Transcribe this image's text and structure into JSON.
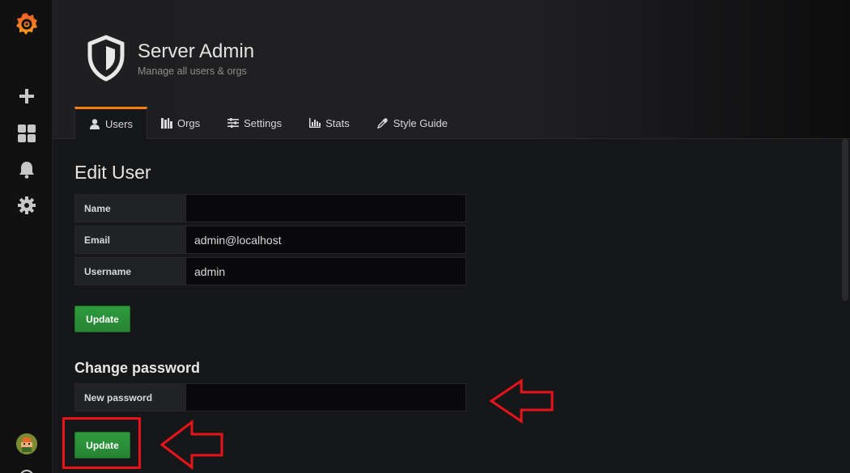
{
  "header": {
    "title": "Server Admin",
    "subtitle": "Manage all users & orgs"
  },
  "sidebar": {
    "icons": [
      "grafana-logo",
      "plus-icon",
      "dashboards-icon",
      "bell-icon",
      "gear-icon",
      "user-avatar",
      "help-icon"
    ]
  },
  "tabs": [
    {
      "label": "Users",
      "icon": "user-icon",
      "active": true
    },
    {
      "label": "Orgs",
      "icon": "building-icon",
      "active": false
    },
    {
      "label": "Settings",
      "icon": "sliders-icon",
      "active": false
    },
    {
      "label": "Stats",
      "icon": "bar-chart-icon",
      "active": false
    },
    {
      "label": "Style Guide",
      "icon": "eyedropper-icon",
      "active": false
    }
  ],
  "edit_user": {
    "title": "Edit User",
    "fields": [
      {
        "label": "Name",
        "value": ""
      },
      {
        "label": "Email",
        "value": "admin@localhost"
      },
      {
        "label": "Username",
        "value": "admin"
      }
    ],
    "update_label": "Update"
  },
  "change_password": {
    "title": "Change password",
    "field_label": "New password",
    "value": "",
    "update_label": "Update"
  },
  "colors": {
    "accent": "#f57f10",
    "button_green": "#299c46",
    "annotation_red": "#e8141a"
  }
}
